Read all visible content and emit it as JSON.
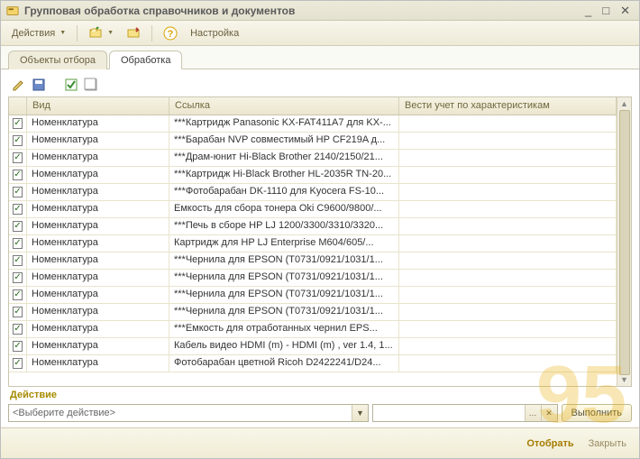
{
  "window": {
    "title": "Групповая обработка справочников и документов"
  },
  "toolbar": {
    "actions_label": "Действия",
    "settings_label": "Настройка"
  },
  "tabs": {
    "selection": "Объекты отбора",
    "processing": "Обработка"
  },
  "grid": {
    "headers": {
      "kind": "Вид",
      "link": "Ссылка",
      "variant": "Вести учет по характеристикам"
    },
    "kind_label": "Номенклатура",
    "rows": [
      {
        "checked": true,
        "link": "***Картридж Panasonic KX-FAT411A7 для KX-..."
      },
      {
        "checked": true,
        "link": "***Барабан NVP совместимый HP CF219A д..."
      },
      {
        "checked": true,
        "link": "***Драм-юнит Hi-Black Brother 2140/2150/21..."
      },
      {
        "checked": true,
        "link": "***Картридж Hi-Black Brother HL-2035R TN-20..."
      },
      {
        "checked": true,
        "link": "***Фотобарабан DK-1110 для Kyocera  FS-10..."
      },
      {
        "checked": true,
        "link": "Емкость для сбора тонера Oki C9600/9800/..."
      },
      {
        "checked": true,
        "link": "***Печь в сборе HP LJ 1200/3300/3310/3320..."
      },
      {
        "checked": true,
        "link": "Картридж для HP LJ Enterprise M604/605/..."
      },
      {
        "checked": true,
        "link": "***Чернила для EPSON (T0731/0921/1031/1..."
      },
      {
        "checked": true,
        "link": "***Чернила для EPSON (T0731/0921/1031/1..."
      },
      {
        "checked": true,
        "link": "***Чернила для EPSON (T0731/0921/1031/1..."
      },
      {
        "checked": true,
        "link": "***Чернила для EPSON (T0731/0921/1031/1..."
      },
      {
        "checked": true,
        "link": "***Емкость для отработанных чернил EPS..."
      },
      {
        "checked": true,
        "link": "Кабель видео HDMI (m) - HDMI (m) , ver 1.4, 1..."
      },
      {
        "checked": true,
        "link": "Фотобарабан цветной  Ricoh  D2422241/D24..."
      }
    ]
  },
  "action_bar": {
    "label": "Действие",
    "combo_placeholder": "<Выберите действие>",
    "execute": "Выполнить"
  },
  "footer": {
    "select": "Отобрать",
    "close": "Закрыть"
  },
  "watermark": "95"
}
